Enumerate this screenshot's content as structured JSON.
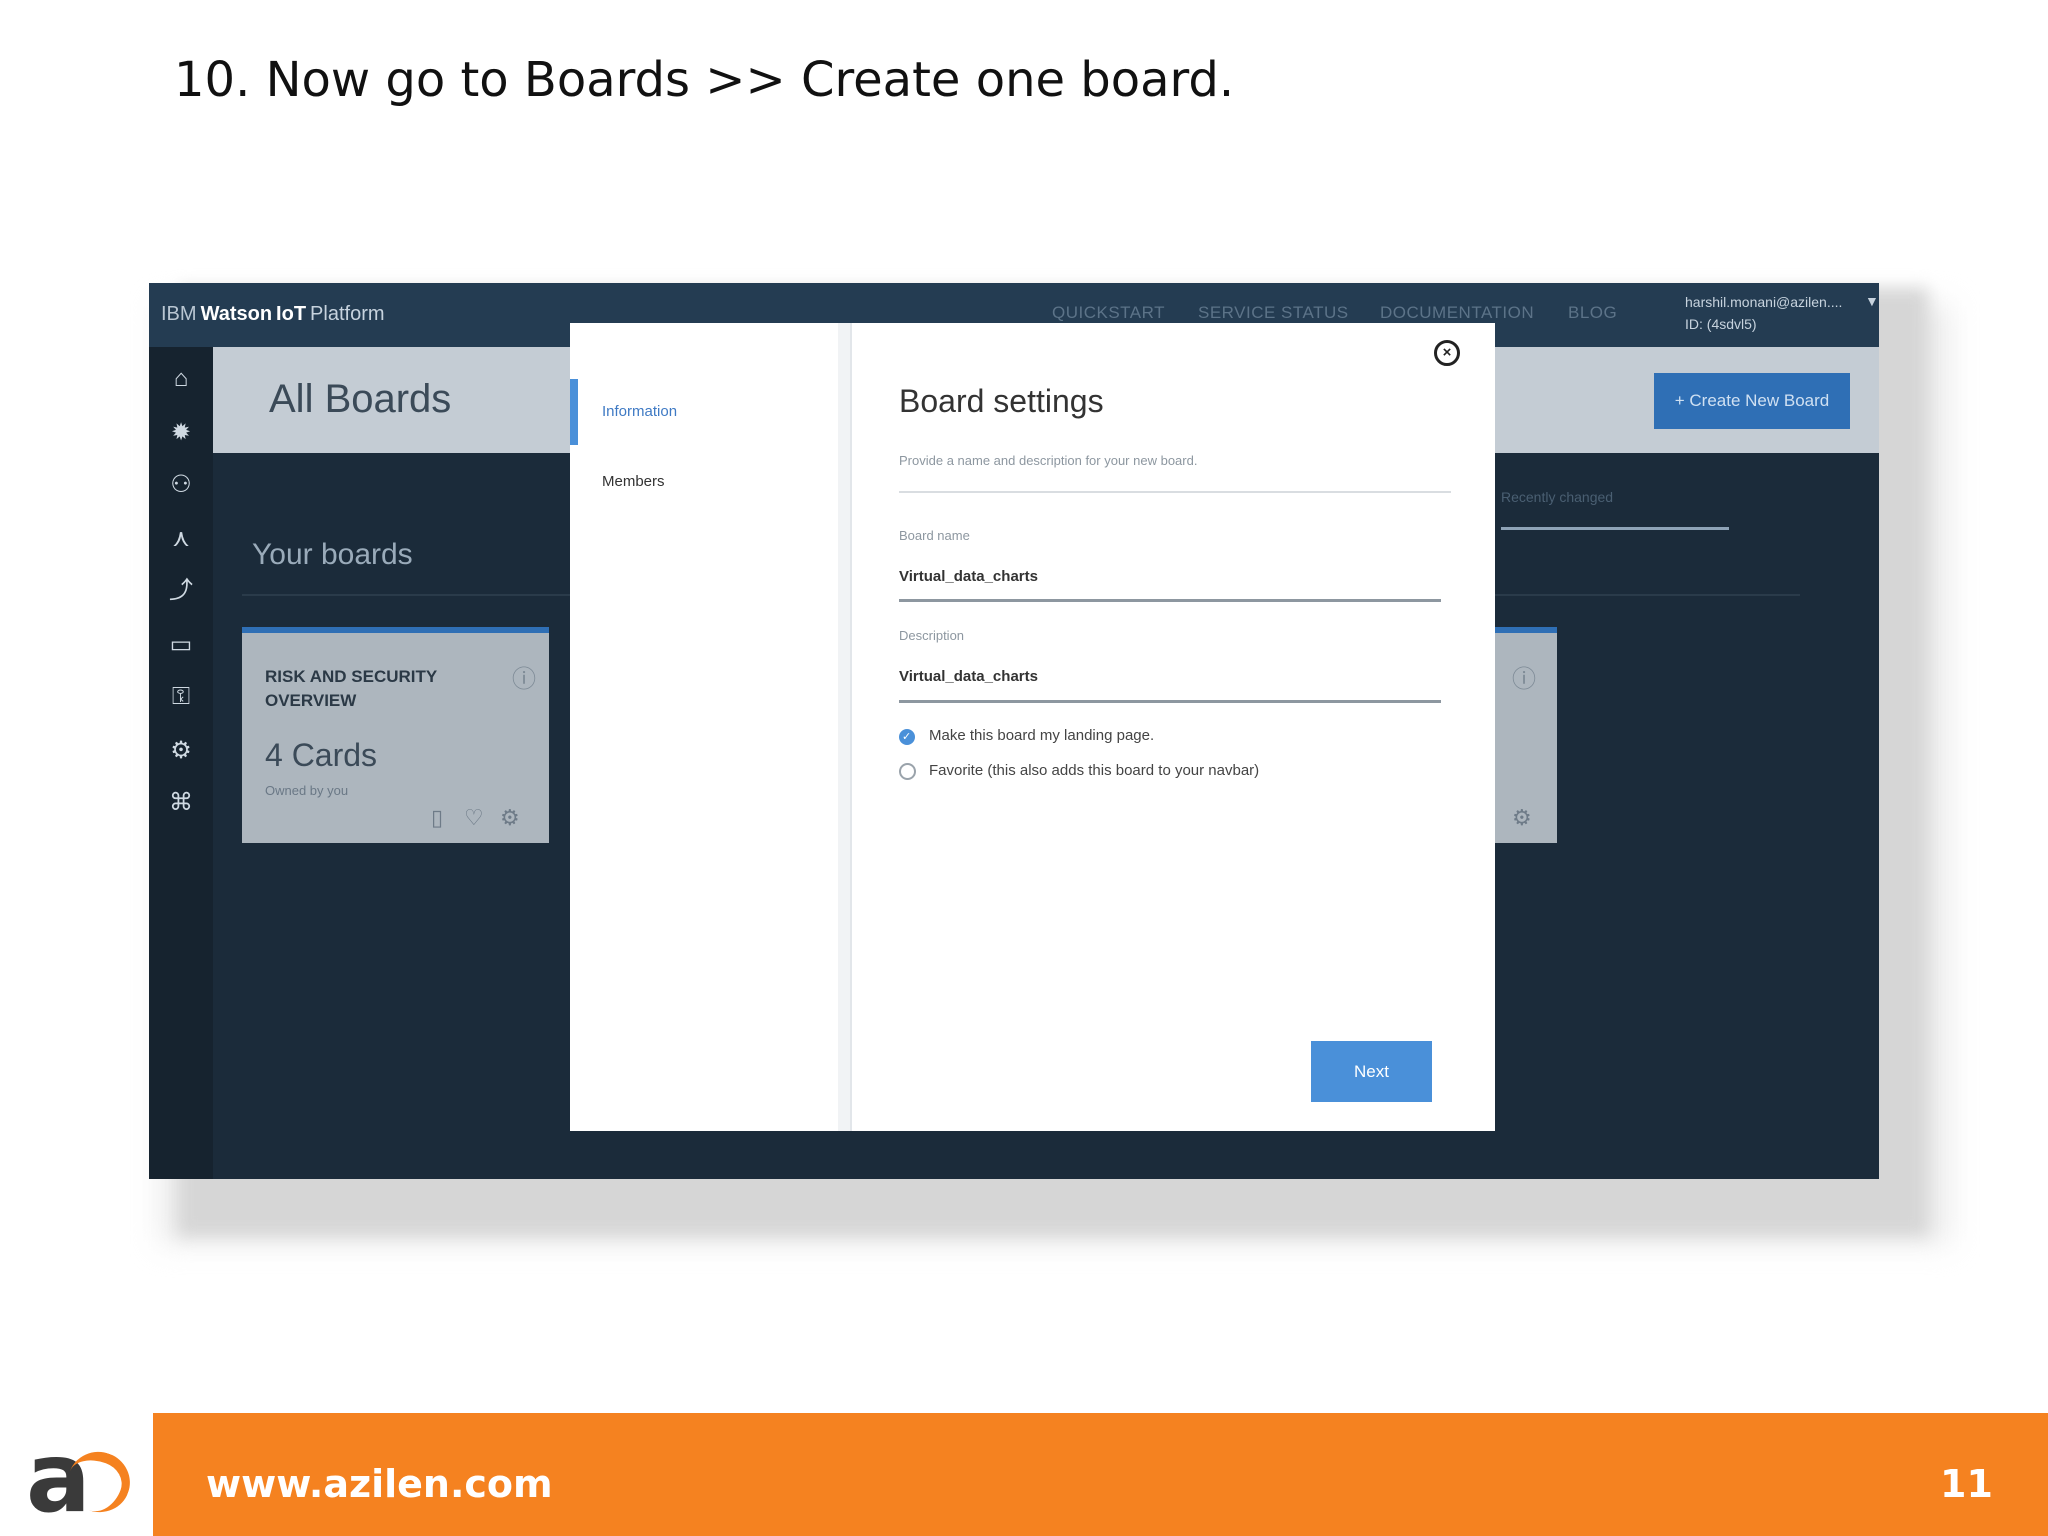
{
  "slide": {
    "heading": "10. Now go to Boards >> Create one board.",
    "footer_url": "www.azilen.com",
    "page_number": "11"
  },
  "app": {
    "brand_ibm": "IBM",
    "brand_watson": "Watson",
    "brand_iot": "IoT",
    "brand_platform": "Platform",
    "nav": [
      "QUICKSTART",
      "SERVICE STATUS",
      "DOCUMENTATION",
      "BLOG"
    ],
    "account_email": "harshil.monani@azilen....",
    "account_id": "ID: (4sdvl5)",
    "page_title": "All Boards",
    "create_button": "+ Create New Board",
    "section_title": "Your boards",
    "sort_placeholder": "Recently changed",
    "card": {
      "title": "RISK AND SECURITY OVERVIEW",
      "count": "4 Cards",
      "owner": "Owned by you"
    }
  },
  "modal": {
    "tabs": [
      "Information",
      "Members"
    ],
    "title": "Board settings",
    "subtitle": "Provide a name and description for your new board.",
    "board_name_label": "Board name",
    "board_name_value": "Virtual_data_charts",
    "description_label": "Description",
    "description_value": "Virtual_data_charts",
    "option_landing": "Make this board my landing page.",
    "option_favorite": "Favorite (this also adds this board to your navbar)",
    "next_button": "Next"
  },
  "colors": {
    "accent_orange": "#f58220",
    "ibm_blue": "#4a90d9",
    "dark_bg": "#1b2b3a"
  }
}
